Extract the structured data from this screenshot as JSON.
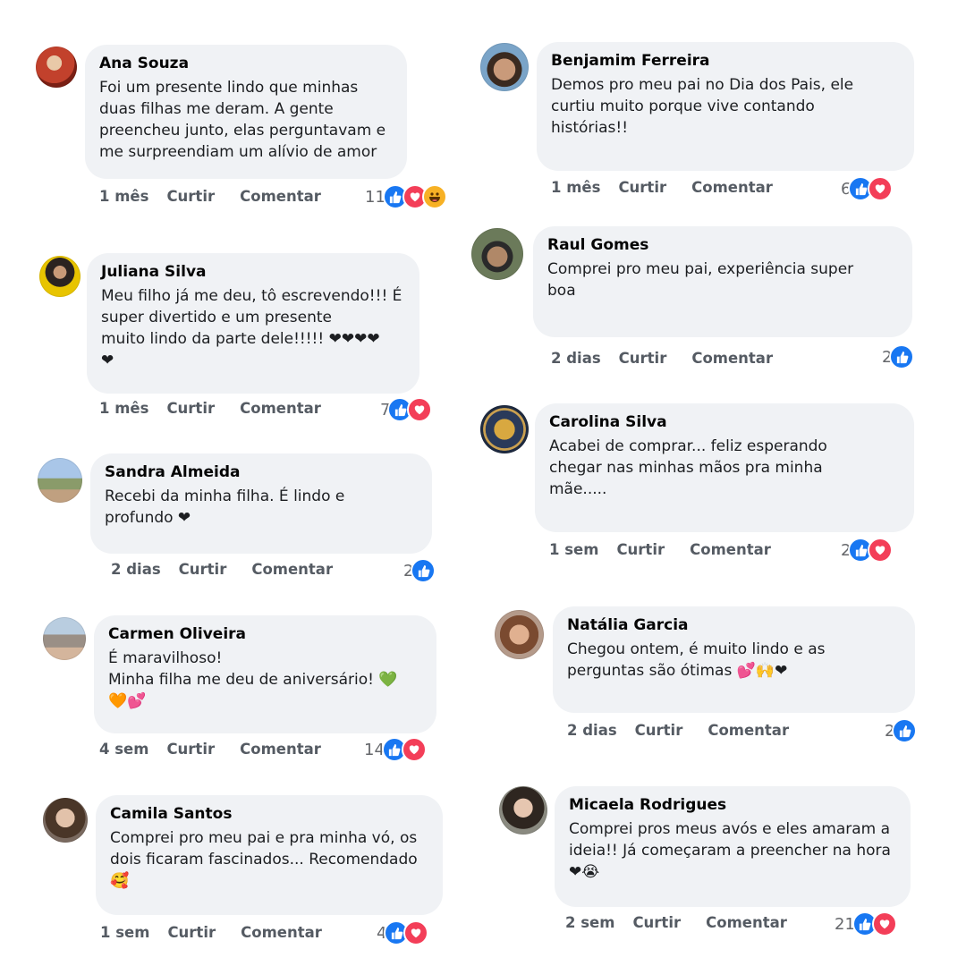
{
  "colors": {
    "bubble": "#f0f2f5",
    "like": "#1877f2",
    "love": "#f33e58",
    "haha": "#f7b125",
    "action_text": "#555b63"
  },
  "comments": [
    {
      "author": "Ana Souza",
      "text": "Foi um presente lindo que minhas\nduas filhas me deram. A gente\npreencheu junto, elas perguntavam e\nme surpreendiam um alívio de amor",
      "time": "1 mês",
      "like_label": "Curtir",
      "reply_label": "Comentar",
      "reaction_count": "11",
      "reactions": [
        "like",
        "love",
        "haha"
      ]
    },
    {
      "author": "Juliana Silva",
      "text": "Meu filho já me deu, tô escrevendo!!! É\nsuper divertido e um presente\nmuito lindo da parte dele!!!!! ❤❤❤❤\n❤",
      "time": "1 mês",
      "like_label": "Curtir",
      "reply_label": "Comentar",
      "reaction_count": "7",
      "reactions": [
        "like",
        "love"
      ]
    },
    {
      "author": "Sandra Almeida",
      "text": "Recebi da minha filha. É lindo e\nprofundo ❤",
      "time": "2 dias",
      "like_label": "Curtir",
      "reply_label": "Comentar",
      "reaction_count": "2",
      "reactions": [
        "like"
      ]
    },
    {
      "author": "Carmen Oliveira",
      "text": "É maravilhoso!\nMinha filha me deu de aniversário! 💚\n🧡💕",
      "time": "4 sem",
      "like_label": "Curtir",
      "reply_label": "Comentar",
      "reaction_count": "14",
      "reactions": [
        "like",
        "love"
      ]
    },
    {
      "author": "Camila Santos",
      "text": "Comprei pro meu pai e pra minha vó, os\ndois ficaram fascinados... Recomendado\n🥰",
      "time": "1 sem",
      "like_label": "Curtir",
      "reply_label": "Comentar",
      "reaction_count": "4",
      "reactions": [
        "like",
        "love"
      ]
    },
    {
      "author": "Benjamim Ferreira",
      "text": "Demos pro meu pai no Dia dos Pais, ele\ncurtiu muito porque vive contando\nhistórias!!",
      "time": "1 mês",
      "like_label": "Curtir",
      "reply_label": "Comentar",
      "reaction_count": "6",
      "reactions": [
        "like",
        "love"
      ]
    },
    {
      "author": "Raul Gomes",
      "text": "Comprei pro meu pai, experiência super\nboa",
      "time": "2 dias",
      "like_label": "Curtir",
      "reply_label": "Comentar",
      "reaction_count": "2",
      "reactions": [
        "like"
      ]
    },
    {
      "author": "Carolina Silva",
      "text": "Acabei de comprar... feliz esperando\nchegar nas minhas mãos pra minha\nmãe.....",
      "time": "1 sem",
      "like_label": "Curtir",
      "reply_label": "Comentar",
      "reaction_count": "2",
      "reactions": [
        "like",
        "love"
      ]
    },
    {
      "author": "Natália Garcia",
      "text": "Chegou ontem, é muito lindo e as\nperguntas são ótimas 💕🙌❤",
      "time": "2 dias",
      "like_label": "Curtir",
      "reply_label": "Comentar",
      "reaction_count": "2",
      "reactions": [
        "like"
      ]
    },
    {
      "author": "Micaela Rodrigues",
      "text": "Comprei pros meus avós e eles amaram a\nideia!! Já começaram a preencher na hora\n❤😭",
      "time": "2 sem",
      "like_label": "Curtir",
      "reply_label": "Comentar",
      "reaction_count": "21",
      "reactions": [
        "like",
        "love"
      ]
    }
  ]
}
